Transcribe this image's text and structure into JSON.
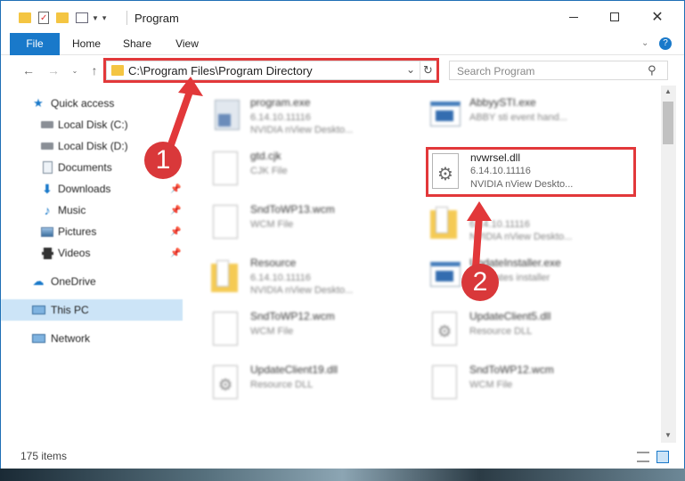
{
  "window": {
    "title": "Program"
  },
  "ribbon": {
    "tabs": [
      "File",
      "Home",
      "Share",
      "View"
    ]
  },
  "nav": {
    "address": "C:\\Program Files\\Program Directory",
    "search_placeholder": "Search Program"
  },
  "sidebar": {
    "items": [
      {
        "label": "Quick access",
        "icon": "star-icon"
      },
      {
        "label": "Local Disk (C:)",
        "icon": "drive-icon"
      },
      {
        "label": "Local Disk (D:)",
        "icon": "drive-icon"
      },
      {
        "label": "Documents",
        "icon": "documents-icon"
      },
      {
        "label": "Downloads",
        "icon": "download-icon"
      },
      {
        "label": "Music",
        "icon": "music-icon"
      },
      {
        "label": "Pictures",
        "icon": "pictures-icon"
      },
      {
        "label": "Videos",
        "icon": "videos-icon"
      },
      {
        "label": "OneDrive",
        "icon": "cloud-icon"
      },
      {
        "label": "This PC",
        "icon": "computer-icon"
      },
      {
        "label": "Network",
        "icon": "network-icon"
      }
    ]
  },
  "files": [
    {
      "name": "program.exe",
      "line1": "6.14.10.11116",
      "line2": "NVIDIA nView Deskto...",
      "icon": "exe-icon"
    },
    {
      "name": "AbbyySTI.exe",
      "line1": "ABBY sti event hand...",
      "line2": "",
      "icon": "window-icon"
    },
    {
      "name": "gtd.cjk",
      "line1": "CJK File",
      "line2": "",
      "icon": "blank-file-icon"
    },
    {
      "name": "nvwrsel.dll",
      "line1": "6.14.10.11116",
      "line2": "NVIDIA nView Deskto...",
      "icon": "dll-gear-icon"
    },
    {
      "name": "SndToWP13.wcm",
      "line1": "WCM File",
      "line2": "",
      "icon": "blank-file-icon"
    },
    {
      "name": "",
      "line1": "6.14.10.11116",
      "line2": "NVIDIA nView Deskto...",
      "icon": "folder-doc-icon"
    },
    {
      "name": "Resource",
      "line1": "6.14.10.11116",
      "line2": "NVIDIA nView Deskto...",
      "icon": "folder-doc-icon"
    },
    {
      "name": "UpdateInstaller.exe",
      "line1": "Y updates installer",
      "line2": "",
      "icon": "window-icon"
    },
    {
      "name": "SndToWP12.wcm",
      "line1": "WCM File",
      "line2": "",
      "icon": "blank-file-icon"
    },
    {
      "name": "UpdateClient5.dll",
      "line1": "Resource DLL",
      "line2": "",
      "icon": "dll-gear-icon"
    },
    {
      "name": "UpdateClient19.dll",
      "line1": "Resource DLL",
      "line2": "",
      "icon": "dll-gear-icon"
    },
    {
      "name": "SndToWP12.wcm",
      "line1": "WCM File",
      "line2": "",
      "icon": "blank-file-icon"
    }
  ],
  "annotations": {
    "step1": "1",
    "step2": "2"
  },
  "status": {
    "items_count": "175 items"
  },
  "colors": {
    "accent": "#1979ca",
    "highlight": "#e2383a",
    "selected": "#cce4f7"
  }
}
